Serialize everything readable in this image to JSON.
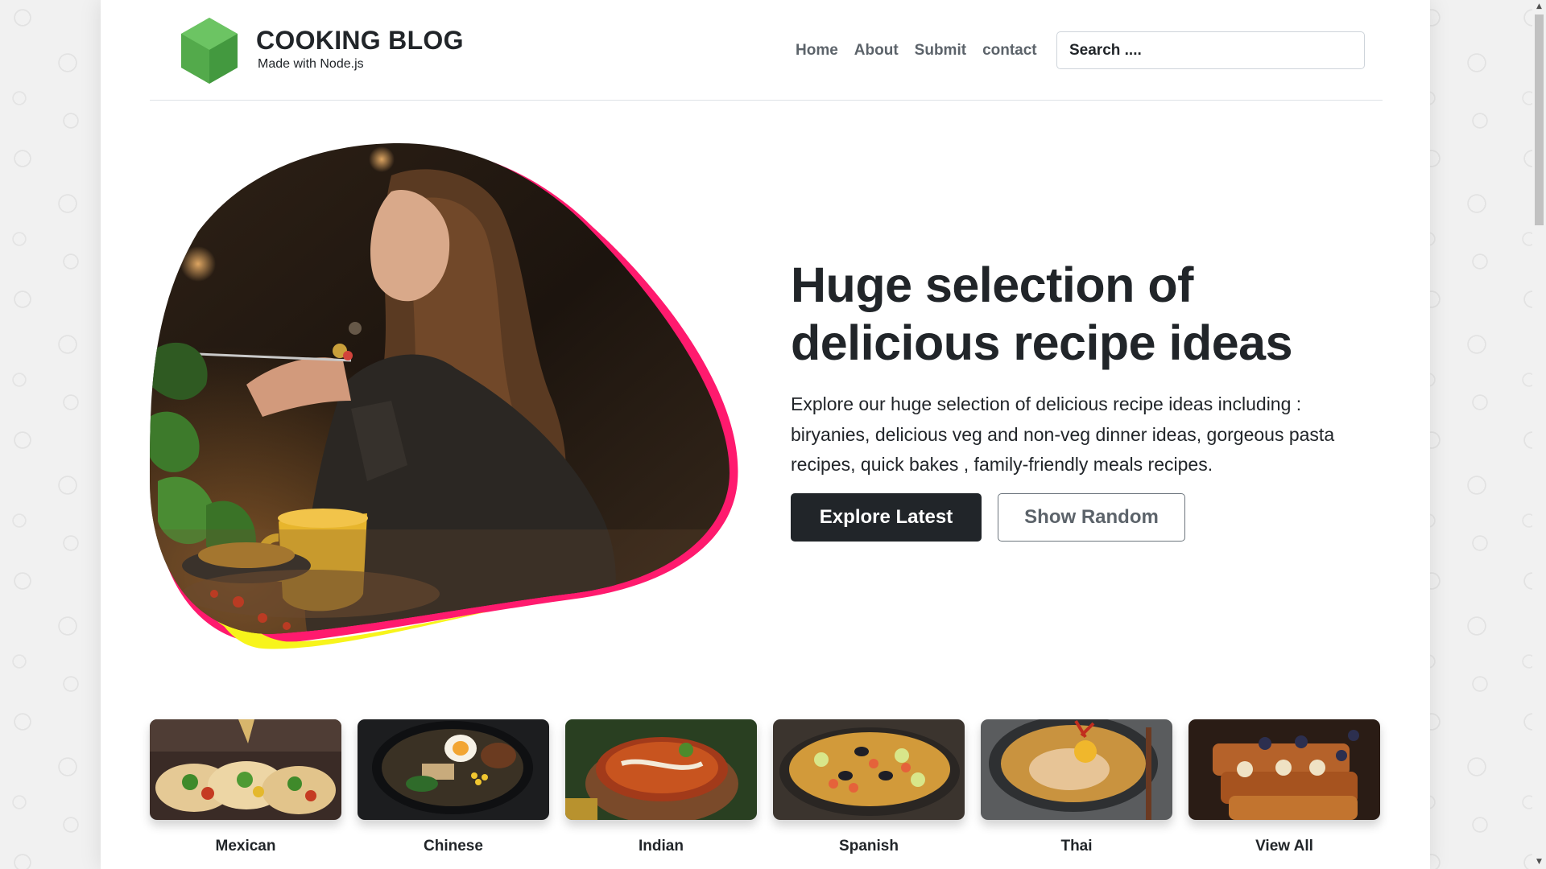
{
  "brand": {
    "title": "COOKING BLOG",
    "subtitle": "Made with Node.js",
    "logo_icon": "nodejs-hexagon-icon",
    "logo_color": "#4caf50"
  },
  "nav": {
    "items": [
      {
        "label": "Home"
      },
      {
        "label": "About"
      },
      {
        "label": "Submit"
      },
      {
        "label": "contact"
      }
    ]
  },
  "search": {
    "placeholder": "Search ...."
  },
  "hero": {
    "image_alt": "Woman enjoying food",
    "title": "Huge selection of delicious recipe ideas",
    "description": "Explore our huge selection of delicious recipe ideas including : biryanies, delicious veg and non-veg dinner ideas, gorgeous pasta recipes, quick bakes , family-friendly meals recipes.",
    "primary_button": "Explore Latest",
    "secondary_button": "Show Random",
    "accent_colors": [
      "#ff1a6e",
      "#f7f41b"
    ]
  },
  "categories": [
    {
      "label": "Mexican"
    },
    {
      "label": "Chinese"
    },
    {
      "label": "Indian"
    },
    {
      "label": "Spanish"
    },
    {
      "label": "Thai"
    },
    {
      "label": "View All"
    }
  ]
}
